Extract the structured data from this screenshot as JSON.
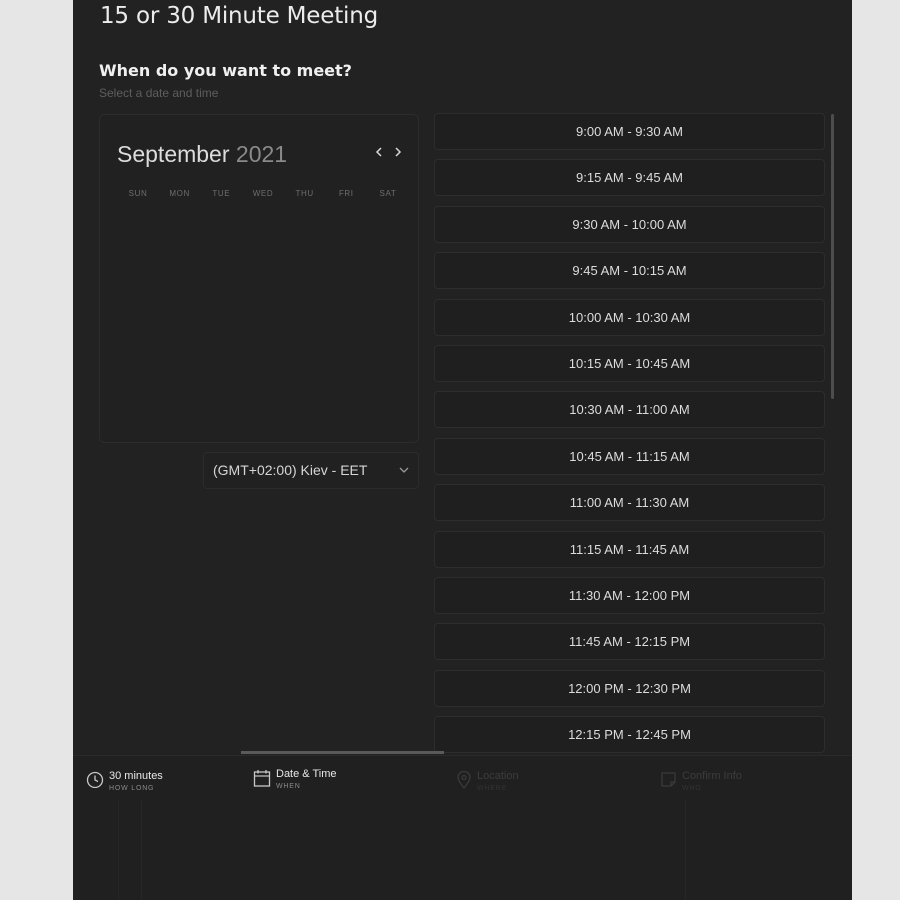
{
  "header": {
    "title": "15 or 30 Minute Meeting",
    "question": "When do you want to meet?",
    "subtitle": "Select a date and time"
  },
  "calendar": {
    "month": "September",
    "year": "2021",
    "weekdays": [
      "SUN",
      "MON",
      "TUE",
      "WED",
      "THU",
      "FRI",
      "SAT"
    ]
  },
  "timezone": {
    "selected": "(GMT+02:00) Kiev - EET"
  },
  "time_slots": [
    "9:00 AM - 9:30 AM",
    "9:15 AM - 9:45 AM",
    "9:30 AM - 10:00 AM",
    "9:45 AM - 10:15 AM",
    "10:00 AM - 10:30 AM",
    "10:15 AM - 10:45 AM",
    "10:30 AM - 11:00 AM",
    "10:45 AM - 11:15 AM",
    "11:00 AM - 11:30 AM",
    "11:15 AM - 11:45 AM",
    "11:30 AM - 12:00 PM",
    "11:45 AM - 12:15 PM",
    "12:00 PM - 12:30 PM",
    "12:15 PM - 12:45 PM"
  ],
  "steps": [
    {
      "label": "30 minutes",
      "sub": "HOW LONG",
      "icon": "clock-icon",
      "state": "done"
    },
    {
      "label": "Date & Time",
      "sub": "WHEN",
      "icon": "calendar-icon",
      "state": "active"
    },
    {
      "label": "Location",
      "sub": "WHERE",
      "icon": "location-pin-icon",
      "state": "disabled"
    },
    {
      "label": "Confirm Info",
      "sub": "WHO",
      "icon": "note-icon",
      "state": "disabled"
    }
  ],
  "colors": {
    "panel_bg": "#222222",
    "page_bg": "#e6e6e6",
    "slot_border": "#2d2d2d",
    "muted_text": "#5e5e5e"
  }
}
